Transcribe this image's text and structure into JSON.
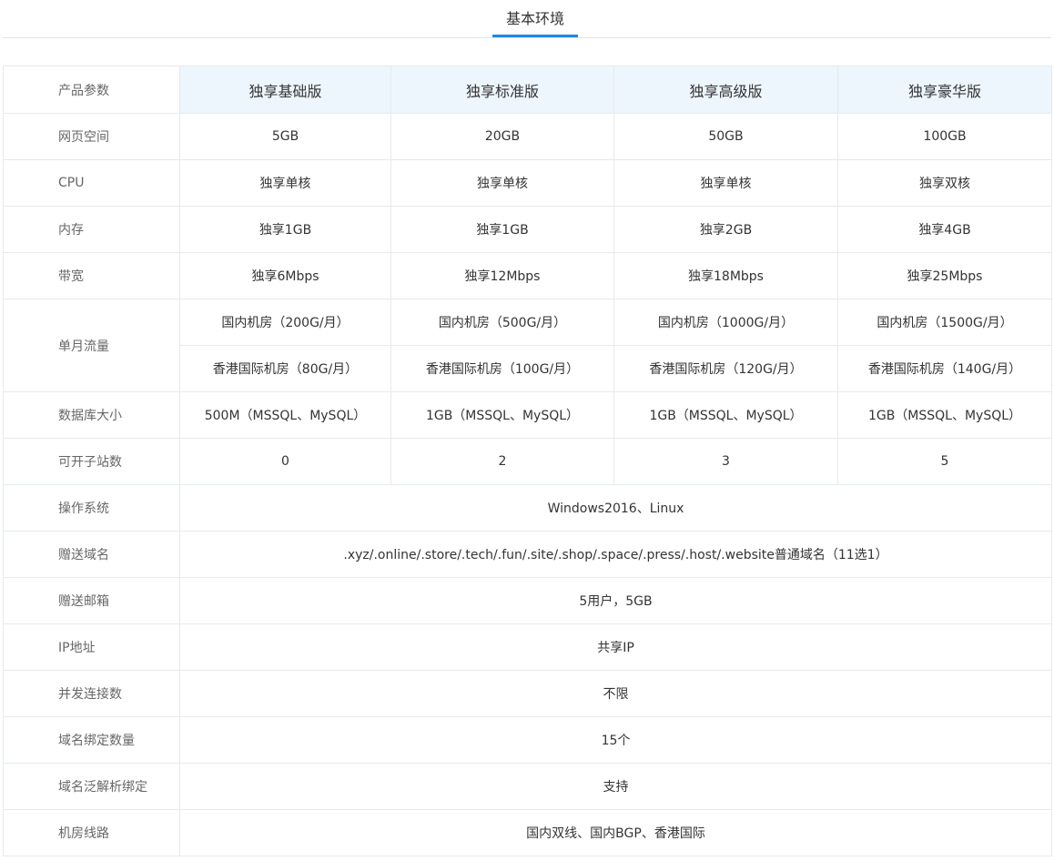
{
  "tab": {
    "label": "基本环境"
  },
  "colors": {
    "accent": "#1e88e5",
    "header_bg": "#edf6fd",
    "border": "#e6e9ee"
  },
  "table": {
    "header_label": "产品参数",
    "plans": [
      "独享基础版",
      "独享标准版",
      "独享高级版",
      "独享豪华版"
    ],
    "rows": [
      {
        "label": "网页空间",
        "values": [
          "5GB",
          "20GB",
          "50GB",
          "100GB"
        ]
      },
      {
        "label": "CPU",
        "values": [
          "独享单核",
          "独享单核",
          "独享单核",
          "独享双核"
        ]
      },
      {
        "label": "内存",
        "values": [
          "独享1GB",
          "独享1GB",
          "独享2GB",
          "独享4GB"
        ]
      },
      {
        "label": "带宽",
        "values": [
          "独享6Mbps",
          "独享12Mbps",
          "独享18Mbps",
          "独享25Mbps"
        ]
      }
    ],
    "traffic": {
      "label": "单月流量",
      "domestic": [
        "国内机房（200G/月）",
        "国内机房（500G/月）",
        "国内机房（1000G/月）",
        "国内机房（1500G/月）"
      ],
      "hongkong": [
        "香港国际机房（80G/月）",
        "香港国际机房（100G/月）",
        "香港国际机房（120G/月）",
        "香港国际机房（140G/月）"
      ]
    },
    "rows_after": [
      {
        "label": "数据库大小",
        "values": [
          "500M（MSSQL、MySQL）",
          "1GB（MSSQL、MySQL）",
          "1GB（MSSQL、MySQL）",
          "1GB（MSSQL、MySQL）"
        ]
      },
      {
        "label": "可开子站数",
        "values": [
          "0",
          "2",
          "3",
          "5"
        ]
      }
    ],
    "shared_rows": [
      {
        "label": "操作系统",
        "value": "Windows2016、Linux"
      },
      {
        "label": "赠送域名",
        "value": ".xyz/.online/.store/.tech/.fun/.site/.shop/.space/.press/.host/.website普通域名（11选1）"
      },
      {
        "label": "赠送邮箱",
        "value": "5用户，5GB"
      },
      {
        "label": "IP地址",
        "value": "共享IP"
      },
      {
        "label": "并发连接数",
        "value": "不限"
      },
      {
        "label": "域名绑定数量",
        "value": "15个"
      },
      {
        "label": "域名泛解析绑定",
        "value": "支持"
      },
      {
        "label": "机房线路",
        "value": "国内双线、国内BGP、香港国际"
      }
    ]
  }
}
